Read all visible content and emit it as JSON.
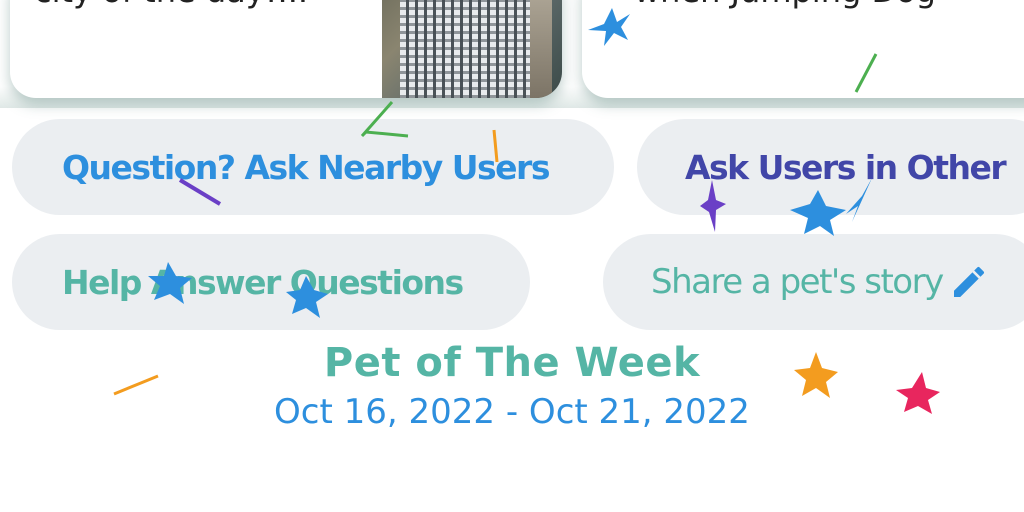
{
  "cards": [
    {
      "text": "city of the day!..."
    },
    {
      "text": "when Jumping Dog"
    }
  ],
  "buttons": {
    "ask_nearby": "Question? Ask Nearby Users",
    "ask_other": "Ask Users in Other",
    "help_answer": "Help Answer Questions",
    "share_story": "Share a pet's story"
  },
  "pet_of_week": {
    "title": "Pet of The Week",
    "date_range": "Oct 16, 2022 - Oct 21, 2022"
  },
  "icons": {
    "share": "pencil-icon"
  },
  "colors": {
    "teal": "#55b5a5",
    "blue": "#2d8fde",
    "indigo": "#4146a8",
    "pill_bg": "#ebeef1",
    "confetti_orange": "#f39c1f",
    "confetti_pink": "#e8265e",
    "confetti_purple": "#6a3fc6",
    "confetti_green": "#4caf50"
  }
}
